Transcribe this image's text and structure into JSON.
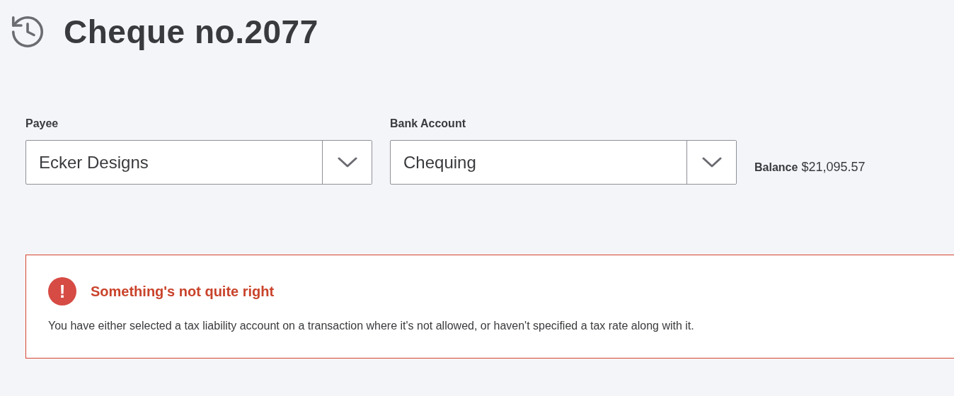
{
  "header": {
    "title": "Cheque no.2077"
  },
  "fields": [
    {
      "label": "Payee",
      "value": "Ecker Designs"
    },
    {
      "label": "Bank Account",
      "value": "Chequing"
    }
  ],
  "balance": {
    "label": "Balance",
    "value": "$21,095.57"
  },
  "alert": {
    "icon": "!",
    "title": "Something's not quite right",
    "message": "You have either selected a tax liability account on a transaction where it's not allowed, or haven't specified a tax rate along with it."
  }
}
